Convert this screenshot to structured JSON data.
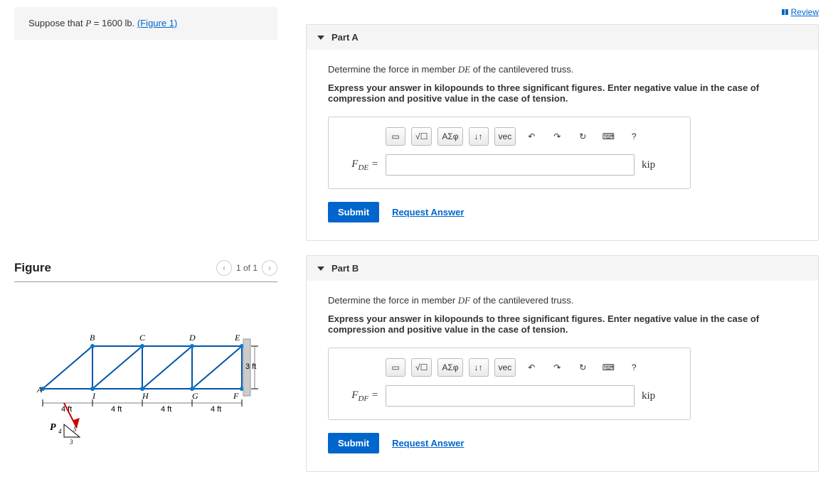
{
  "review_label": "Review",
  "problem": {
    "prefix": "Suppose that ",
    "var": "P",
    "equals": " = ",
    "value": "1600 lb",
    "period": ". ",
    "figure_link": "(Figure 1)"
  },
  "figure": {
    "title": "Figure",
    "counter": "1 of 1",
    "nodes": {
      "A": "A",
      "B": "B",
      "C": "C",
      "D": "D",
      "E": "E",
      "F": "F",
      "G": "G",
      "H": "H",
      "I": "I"
    },
    "dims": {
      "span": "4 ft",
      "height": "3 ft"
    },
    "load": {
      "P": "P",
      "ratio1": "4",
      "ratio2": "5",
      "ratio3": "3"
    }
  },
  "partA": {
    "title": "Part A",
    "prompt_pre": "Determine the force in member ",
    "prompt_var": "DE",
    "prompt_post": " of the cantilevered truss.",
    "instructions": "Express your answer in kilopounds to three significant figures. Enter negative value in the case of compression and positive value in the case of tension.",
    "var_label_main": "F",
    "var_label_sub": "DE",
    "unit": "kip"
  },
  "partB": {
    "title": "Part B",
    "prompt_pre": "Determine the force in member ",
    "prompt_var": "DF",
    "prompt_post": " of the cantilevered truss.",
    "instructions": "Express your answer in kilopounds to three significant figures. Enter negative value in the case of compression and positive value in the case of tension.",
    "var_label_main": "F",
    "var_label_sub": "DF",
    "unit": "kip"
  },
  "toolbar": {
    "template": "▭",
    "root": "√☐",
    "greek": "ΑΣφ",
    "arrows": "↓↑",
    "vec": "vec",
    "undo": "↶",
    "redo": "↷",
    "reset": "↻",
    "keyboard": "⌨",
    "help": "?"
  },
  "actions": {
    "submit": "Submit",
    "request": "Request Answer"
  }
}
